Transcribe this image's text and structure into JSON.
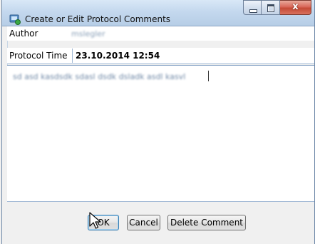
{
  "window": {
    "title": "Create or Edit Protocol Comments",
    "close_glyph": "x"
  },
  "form": {
    "author_label": "Author",
    "author_value": "mslegler",
    "protocol_time_label": "Protocol Time",
    "protocol_time_value": "23.10.2014 12:54",
    "comment_text": "sd asd kasdsdk sdasl dsdk dsladk asdl kasvl"
  },
  "buttons": {
    "ok_label": "OK",
    "cancel_label": "Cancel",
    "delete_label": "Delete Comment"
  },
  "icons": {
    "app": "protocol-app-icon",
    "minimize": "minimize-icon",
    "maximize": "maximize-icon",
    "close": "close-icon",
    "cursor": "mouse-pointer-icon"
  },
  "colors": {
    "titlebar": "#c4d8ee",
    "close_button": "#c44a36",
    "default_button_border": "#3c7fb1"
  }
}
